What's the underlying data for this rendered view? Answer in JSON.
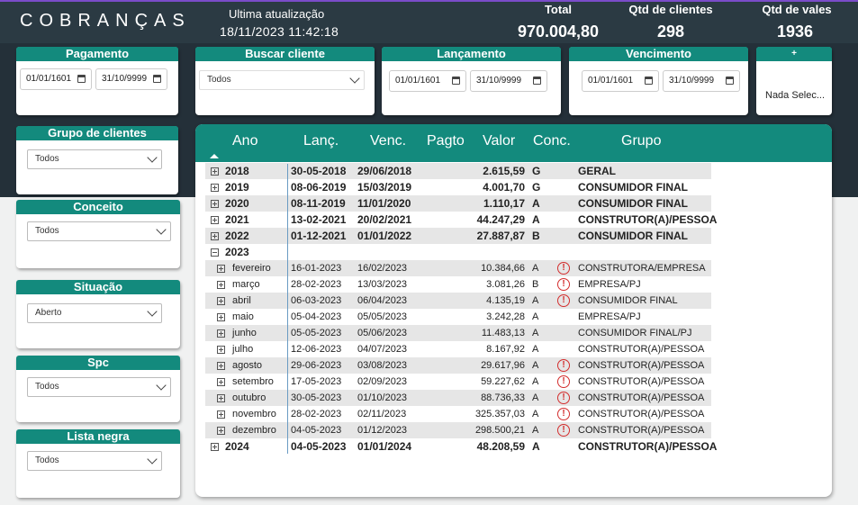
{
  "header": {
    "title": "COBRANÇAS",
    "update_label": "Ultima atualização",
    "update_value": "18/11/2023 11:42:18",
    "kpis": [
      {
        "label": "Total",
        "value": "970.004,80"
      },
      {
        "label": "Qtd de clientes",
        "value": "298"
      },
      {
        "label": "Qtd de vales",
        "value": "1936"
      }
    ]
  },
  "filters": {
    "pagamento": {
      "title": "Pagamento",
      "from": "01/01/1601",
      "to": "31/10/9999"
    },
    "buscar_cliente": {
      "title": "Buscar cliente",
      "value": "Todos"
    },
    "lancamento": {
      "title": "Lançamento",
      "from": "01/01/1601",
      "to": "31/10/9999"
    },
    "vencimento": {
      "title": "Vencimento",
      "from": "01/01/1601",
      "to": "31/10/9999"
    },
    "extra": {
      "title": "+",
      "value": "Nada Selec..."
    },
    "grupo_clientes": {
      "title": "Grupo de clientes",
      "value": "Todos"
    },
    "conceito": {
      "title": "Conceito",
      "value": "Todos"
    },
    "situacao": {
      "title": "Situação",
      "value": "Aberto"
    },
    "spc": {
      "title": "Spc",
      "value": "Todos"
    },
    "lista_negra": {
      "title": "Lista negra",
      "value": "Todos"
    }
  },
  "matrix": {
    "columns": [
      "Ano",
      "Lanç.",
      "Venc.",
      "Pagto",
      "Valor",
      "Conc.",
      "Grupo"
    ],
    "rows": [
      {
        "label": "2018",
        "lanc": "30-05-2018",
        "venc": "29/06/2018",
        "valor": "2.615,59",
        "conc": "G",
        "grupo": "GERAL",
        "level": 0,
        "expanded": false,
        "warn": false
      },
      {
        "label": "2019",
        "lanc": "08-06-2019",
        "venc": "15/03/2019",
        "valor": "4.001,70",
        "conc": "G",
        "grupo": "CONSUMIDOR FINAL",
        "level": 0,
        "expanded": false,
        "warn": false
      },
      {
        "label": "2020",
        "lanc": "08-11-2019",
        "venc": "11/01/2020",
        "valor": "1.110,17",
        "conc": "A",
        "grupo": "CONSUMIDOR FINAL",
        "level": 0,
        "expanded": false,
        "warn": false
      },
      {
        "label": "2021",
        "lanc": "13-02-2021",
        "venc": "20/02/2021",
        "valor": "44.247,29",
        "conc": "A",
        "grupo": "CONSTRUTOR(A)/PESSOA",
        "level": 0,
        "expanded": false,
        "warn": false
      },
      {
        "label": "2022",
        "lanc": "01-12-2021",
        "venc": "01/01/2022",
        "valor": "27.887,87",
        "conc": "B",
        "grupo": "CONSUMIDOR FINAL",
        "level": 0,
        "expanded": false,
        "warn": false
      },
      {
        "label": "2023",
        "lanc": "",
        "venc": "",
        "valor": "",
        "conc": "",
        "grupo": "",
        "level": 0,
        "expanded": true,
        "warn": false
      },
      {
        "label": "fevereiro",
        "lanc": "16-01-2023",
        "venc": "16/02/2023",
        "valor": "10.384,66",
        "conc": "A",
        "grupo": "CONSTRUTORA/EMPRESA",
        "level": 1,
        "expanded": false,
        "warn": true
      },
      {
        "label": "março",
        "lanc": "28-02-2023",
        "venc": "13/03/2023",
        "valor": "3.081,26",
        "conc": "B",
        "grupo": "EMPRESA/PJ",
        "level": 1,
        "expanded": false,
        "warn": true
      },
      {
        "label": "abril",
        "lanc": "06-03-2023",
        "venc": "06/04/2023",
        "valor": "4.135,19",
        "conc": "A",
        "grupo": "CONSUMIDOR FINAL",
        "level": 1,
        "expanded": false,
        "warn": true
      },
      {
        "label": "maio",
        "lanc": "05-04-2023",
        "venc": "05/05/2023",
        "valor": "3.242,28",
        "conc": "A",
        "grupo": "EMPRESA/PJ",
        "level": 1,
        "expanded": false,
        "warn": false
      },
      {
        "label": "junho",
        "lanc": "05-05-2023",
        "venc": "05/06/2023",
        "valor": "11.483,13",
        "conc": "A",
        "grupo": "CONSUMIDOR FINAL/PJ",
        "level": 1,
        "expanded": false,
        "warn": false
      },
      {
        "label": "julho",
        "lanc": "12-06-2023",
        "venc": "04/07/2023",
        "valor": "8.167,92",
        "conc": "A",
        "grupo": "CONSTRUTOR(A)/PESSOA",
        "level": 1,
        "expanded": false,
        "warn": false
      },
      {
        "label": "agosto",
        "lanc": "29-06-2023",
        "venc": "03/08/2023",
        "valor": "29.617,96",
        "conc": "A",
        "grupo": "CONSTRUTOR(A)/PESSOA",
        "level": 1,
        "expanded": false,
        "warn": true
      },
      {
        "label": "setembro",
        "lanc": "17-05-2023",
        "venc": "02/09/2023",
        "valor": "59.227,62",
        "conc": "A",
        "grupo": "CONSTRUTOR(A)/PESSOA",
        "level": 1,
        "expanded": false,
        "warn": true
      },
      {
        "label": "outubro",
        "lanc": "30-05-2023",
        "venc": "01/10/2023",
        "valor": "88.736,33",
        "conc": "A",
        "grupo": "CONSTRUTOR(A)/PESSOA",
        "level": 1,
        "expanded": false,
        "warn": true
      },
      {
        "label": "novembro",
        "lanc": "28-02-2023",
        "venc": "02/11/2023",
        "valor": "325.357,03",
        "conc": "A",
        "grupo": "CONSTRUTOR(A)/PESSOA",
        "level": 1,
        "expanded": false,
        "warn": true
      },
      {
        "label": "dezembro",
        "lanc": "04-05-2023",
        "venc": "01/12/2023",
        "valor": "298.500,21",
        "conc": "A",
        "grupo": "CONSTRUTOR(A)/PESSOA",
        "level": 1,
        "expanded": false,
        "warn": true
      },
      {
        "label": "2024",
        "lanc": "04-05-2023",
        "venc": "01/01/2024",
        "valor": "48.208,59",
        "conc": "A",
        "grupo": "CONSTRUTOR(A)/PESSOA",
        "level": 0,
        "expanded": false,
        "warn": false
      }
    ]
  },
  "icons": {
    "calendar": "calendar-icon",
    "chevron": "chevron-down-icon",
    "warning": "warning-icon",
    "expand": "expand-icon",
    "collapse": "collapse-icon",
    "sort": "sort-ascending-icon"
  },
  "colors": {
    "header_bg": "#2b3a43",
    "accent": "#138a7d",
    "warning": "#d32d2d"
  }
}
